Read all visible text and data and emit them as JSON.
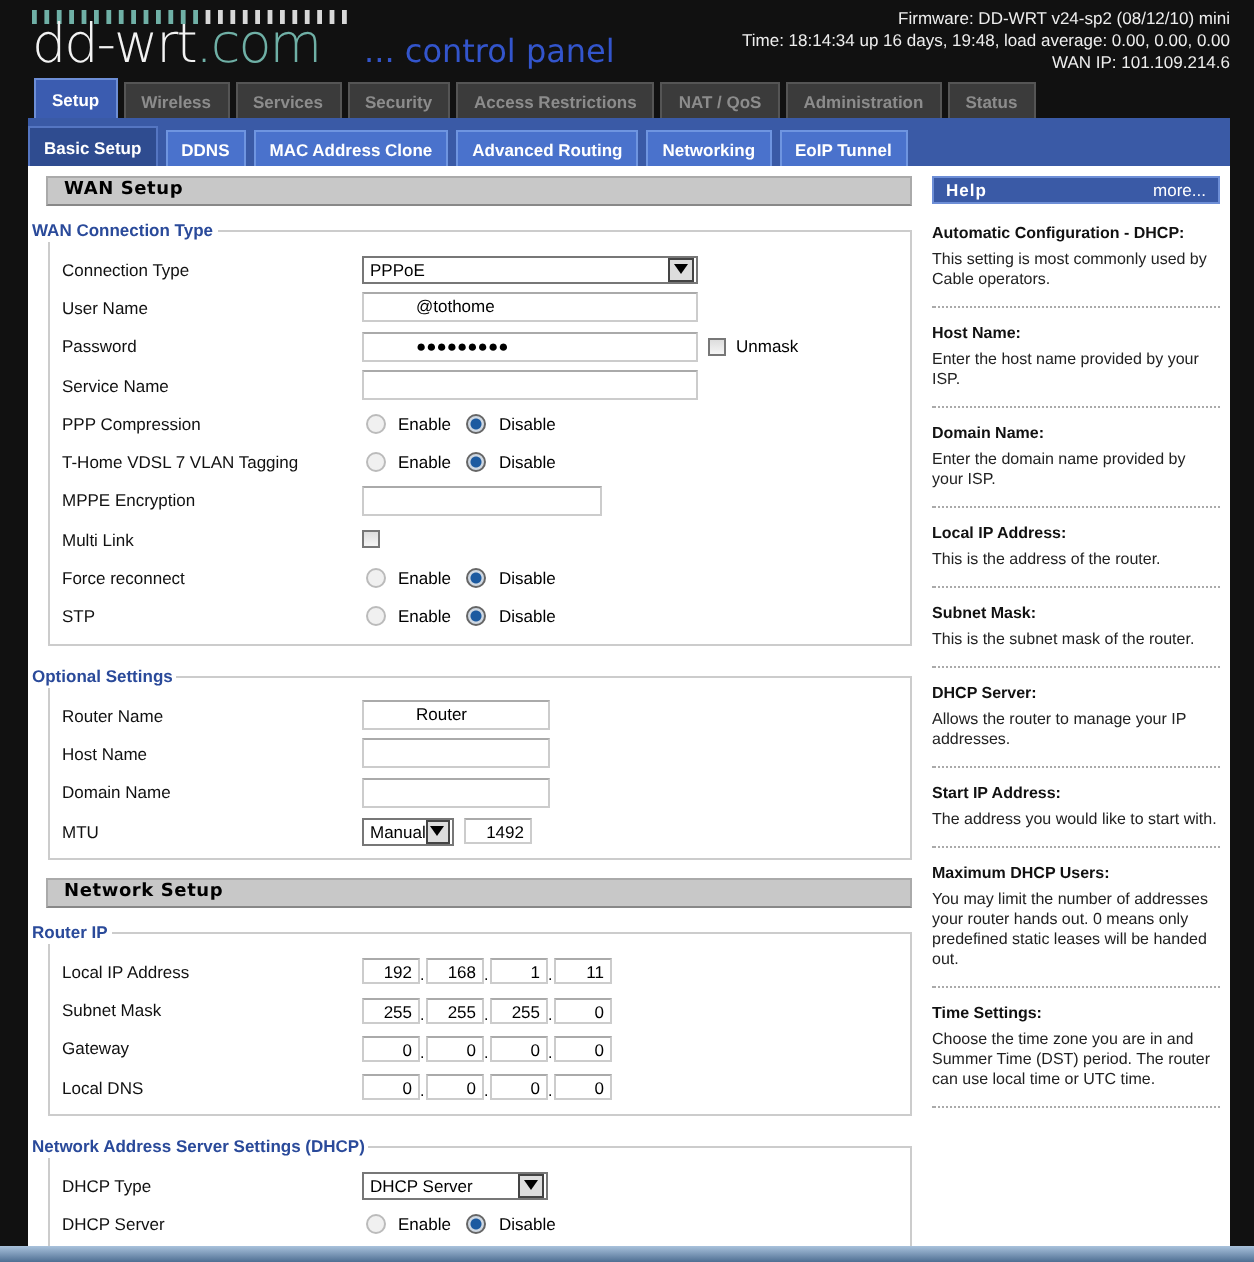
{
  "header": {
    "logo_parts": [
      "dd-wrt",
      ".com"
    ],
    "tagline": "... control panel",
    "info": [
      "Firmware: DD-WRT v24-sp2 (08/12/10) mini",
      "Time: 18:14:34 up 16 days, 19:48, load average: 0.00, 0.00, 0.00",
      "WAN IP: 101.109.214.6"
    ]
  },
  "tabs": [
    {
      "label": "Setup",
      "selected": true
    },
    {
      "label": "Wireless",
      "selected": false
    },
    {
      "label": "Services",
      "selected": false
    },
    {
      "label": "Security",
      "selected": false
    },
    {
      "label": "Access Restrictions",
      "selected": false
    },
    {
      "label": "NAT / QoS",
      "selected": false
    },
    {
      "label": "Administration",
      "selected": false
    },
    {
      "label": "Status",
      "selected": false
    }
  ],
  "subtabs": [
    {
      "label": "Basic Setup",
      "selected": true
    },
    {
      "label": "DDNS",
      "selected": false
    },
    {
      "label": "MAC Address Clone",
      "selected": false
    },
    {
      "label": "Advanced Routing",
      "selected": false
    },
    {
      "label": "Networking",
      "selected": false
    },
    {
      "label": "EoIP Tunnel",
      "selected": false
    }
  ],
  "sections": [
    {
      "kind": "header",
      "title": "WAN Setup"
    },
    {
      "kind": "fieldset",
      "legend": "WAN Connection Type",
      "rows": [
        {
          "kind": "select",
          "label": "Connection Type",
          "value": "PPPoE"
        },
        {
          "kind": "text",
          "label": "User Name",
          "value": "@tothome"
        },
        {
          "kind": "text",
          "label": "Password",
          "value": "●●●●●●●●●",
          "toggle": {
            "label": "Unmask",
            "checked": false
          }
        },
        {
          "kind": "text",
          "label": "Service Name"
        },
        {
          "kind": "radio",
          "label": "PPP Compression",
          "options": [
            {
              "label": "Enable",
              "selected": false
            },
            {
              "label": "Disable",
              "selected": true
            }
          ]
        },
        {
          "kind": "radio",
          "label": "T-Home VDSL 7 VLAN Tagging",
          "options": [
            {
              "label": "Enable",
              "selected": false
            },
            {
              "label": "Disable",
              "selected": true
            }
          ]
        },
        {
          "kind": "text",
          "label": "MPPE Encryption"
        },
        {
          "kind": "checkbox",
          "label": "Multi Link",
          "checked": false
        },
        {
          "kind": "radio",
          "label": "Force reconnect",
          "options": [
            {
              "label": "Enable",
              "selected": false
            },
            {
              "label": "Disable",
              "selected": true
            }
          ]
        },
        {
          "kind": "radio",
          "label": "STP",
          "options": [
            {
              "label": "Enable",
              "selected": false
            },
            {
              "label": "Disable",
              "selected": true
            }
          ]
        }
      ]
    },
    {
      "kind": "fieldset",
      "legend": "Optional Settings",
      "rows": [
        {
          "kind": "text",
          "label": "Router Name",
          "value": "Router"
        },
        {
          "kind": "text",
          "label": "Host Name"
        },
        {
          "kind": "text",
          "label": "Domain Name"
        },
        {
          "kind": "select_input",
          "label": "MTU",
          "value": "Manual",
          "input": "1492"
        }
      ]
    },
    {
      "kind": "header",
      "title": "Network Setup"
    },
    {
      "kind": "fieldset",
      "legend": "Router IP",
      "rows": [
        {
          "kind": "ip",
          "label": "Local IP Address",
          "octets": [
            "192",
            "168",
            "1",
            "11"
          ],
          "separator": "."
        },
        {
          "kind": "ip",
          "label": "Subnet Mask",
          "octets": [
            "255",
            "255",
            "255",
            "0"
          ],
          "separator": "."
        },
        {
          "kind": "ip",
          "label": "Gateway",
          "octets": [
            "0",
            "0",
            "0",
            "0"
          ],
          "separator": "."
        },
        {
          "kind": "ip",
          "label": "Local DNS",
          "octets": [
            "0",
            "0",
            "0",
            "0"
          ],
          "separator": "."
        }
      ]
    },
    {
      "kind": "fieldset",
      "legend": "Network Address Server Settings (DHCP)",
      "rows": [
        {
          "kind": "select",
          "label": "DHCP Type",
          "value": "DHCP Server"
        },
        {
          "kind": "radio",
          "label": "DHCP Server",
          "options": [
            {
              "label": "Enable",
              "selected": false
            },
            {
              "label": "Disable",
              "selected": true
            }
          ]
        }
      ]
    }
  ],
  "help": {
    "title": "Help",
    "more": "more...",
    "items": [
      {
        "title": "Automatic Configuration - DHCP:",
        "text": "This setting is most commonly used by Cable operators."
      },
      {
        "title": "Host Name:",
        "text": "Enter the host name provided by your ISP."
      },
      {
        "title": "Domain Name:",
        "text": "Enter the domain name provided by your ISP."
      },
      {
        "title": "Local IP Address:",
        "text": "This is the address of the router."
      },
      {
        "title": "Subnet Mask:",
        "text": "This is the subnet mask of the router."
      },
      {
        "title": "DHCP Server:",
        "text": "Allows the router to manage your IP addresses."
      },
      {
        "title": "Start IP Address:",
        "text": "The address you would like to start with."
      },
      {
        "title": "Maximum DHCP Users:",
        "text": "You may limit the number of addresses your router hands out. 0 means only predefined static leases will be handed out."
      },
      {
        "title": "Time Settings:",
        "text": "Choose the time zone you are in and Summer Time (DST) period. The router can use local time or UTC time."
      }
    ]
  }
}
